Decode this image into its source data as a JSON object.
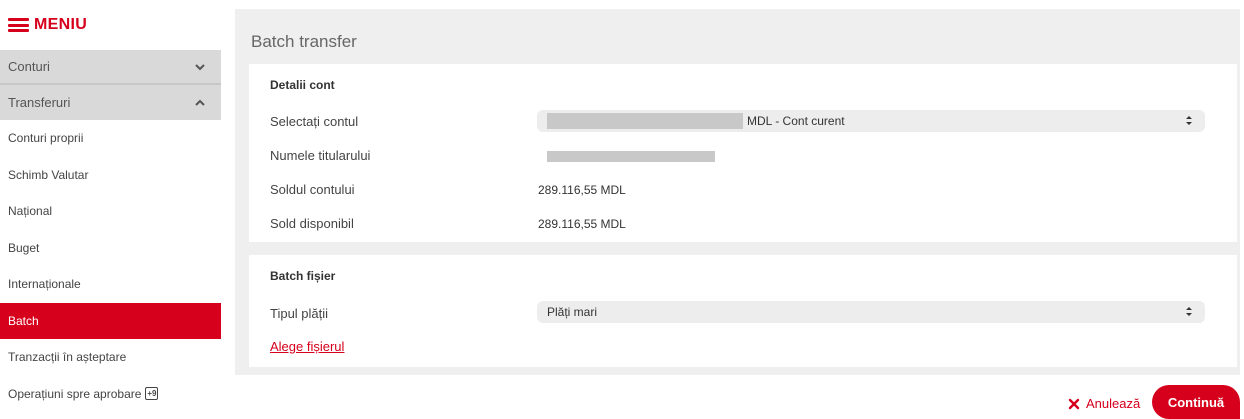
{
  "sidebar": {
    "menu_title": "MENIU",
    "groups": [
      {
        "label": "Conturi",
        "state": "collapsed"
      },
      {
        "label": "Transferuri",
        "state": "expanded"
      }
    ],
    "items": [
      {
        "label": "Conturi proprii"
      },
      {
        "label": "Schimb Valutar"
      },
      {
        "label": "Național"
      },
      {
        "label": "Buget"
      },
      {
        "label": "Internaționale"
      },
      {
        "label": "Batch",
        "active": true
      },
      {
        "label": "Tranzacții în așteptare"
      },
      {
        "label": "Operațiuni spre aprobare",
        "badge": "+9"
      }
    ]
  },
  "main": {
    "title": "Batch transfer",
    "account_card": {
      "heading": "Detalii cont",
      "select_account_label": "Selectați contul",
      "select_account_value": "MDL - Cont curent",
      "holder_label": "Numele titularului",
      "balance_label": "Soldul contului",
      "balance_value": "289.116,55 MDL",
      "available_label": "Sold disponibil",
      "available_value": "289.116,55 MDL"
    },
    "batch_card": {
      "heading": "Batch fișier",
      "payment_type_label": "Tipul plății",
      "payment_type_value": "Plăți mari",
      "choose_file_link": "Alege fișierul"
    }
  },
  "actions": {
    "cancel_label": "Anulează",
    "continue_label": "Continuă"
  },
  "colors": {
    "accent": "#d6001c",
    "sidebar_group_bg": "#d9d9d9",
    "main_bg": "#efefef"
  }
}
